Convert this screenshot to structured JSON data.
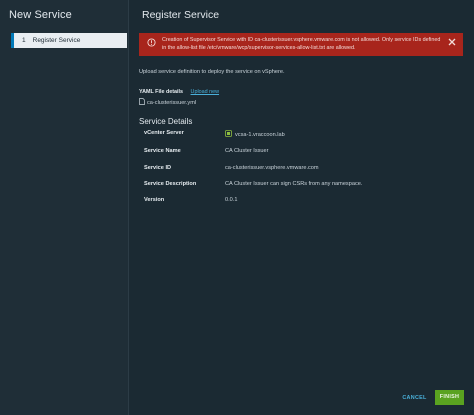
{
  "wizard": {
    "title": "New Service",
    "steps": [
      {
        "number": "1",
        "label": "Register Service"
      }
    ]
  },
  "main": {
    "title": "Register Service",
    "alert": {
      "message": "Creation of Supervisor Service with ID ca-clusterissuer.vsphere.vmware.com is not allowed. Only service IDs defined in the allow-list file /etc/vmware/wcp/supervisor-services-allow-list.txt are allowed."
    },
    "upload_description": "Upload service definition to deploy the service on vSphere.",
    "yaml_label": "YAML File details",
    "upload_link": "Upload new",
    "file_name": "ca-clusterissuer.yml",
    "section_title": "Service Details",
    "details": [
      {
        "key": "vCenter Server",
        "value": "vcsa-1.vraccoon.lab"
      },
      {
        "key": "Service Name",
        "value": "CA Cluster Issuer"
      },
      {
        "key": "Service ID",
        "value": "ca-clusterissuer.vsphere.vmware.com"
      },
      {
        "key": "Service Description",
        "value": "CA Cluster Issuer can sign CSRs from any namespace."
      },
      {
        "key": "Version",
        "value": "0.0.1"
      }
    ]
  },
  "footer": {
    "cancel_label": "CANCEL",
    "finish_label": "FINISH"
  },
  "colors": {
    "background": "#1b2a33",
    "alert": "#a8251c",
    "link": "#49afd9",
    "finish": "#5aa220"
  },
  "icons": [
    "error-icon",
    "close-icon",
    "file-icon",
    "vcenter-icon"
  ]
}
